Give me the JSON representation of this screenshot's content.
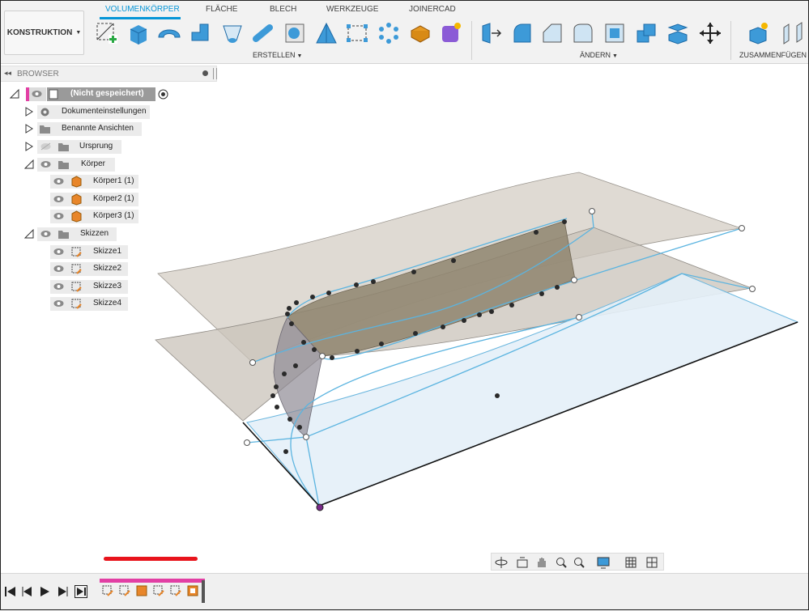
{
  "toolbar": {
    "workspace_label": "KONSTRUKTION",
    "tabs": [
      "VOLUMENKÖRPER",
      "FLÄCHE",
      "BLECH",
      "WERKZEUGE",
      "JOINERCAD"
    ],
    "active_tab": "VOLUMENKÖRPER",
    "groups": {
      "create": "ERSTELLEN",
      "modify": "ÄNDERN",
      "assemble": "ZUSAMMENFÜGEN"
    },
    "create_icons": [
      "sketch-icon",
      "extrude-icon",
      "revolve-icon",
      "sweep-icon",
      "loft-icon",
      "pipe-icon",
      "hole-icon",
      "thread-icon",
      "rib-icon",
      "web-icon",
      "pattern-icon",
      "emboss-icon",
      "form-icon"
    ],
    "modify_icons": [
      "press-pull-icon",
      "fillet-icon",
      "chamfer-icon",
      "shell-icon",
      "draft-icon",
      "combine-icon",
      "split-icon",
      "move-icon"
    ],
    "assemble_icons": [
      "new-component-icon",
      "joint-icon"
    ]
  },
  "browser": {
    "title": "BROWSER",
    "root": "(Nicht gespeichert)",
    "items": [
      {
        "label": "Dokumenteinstellungen"
      },
      {
        "label": "Benannte Ansichten"
      },
      {
        "label": "Ursprung"
      },
      {
        "label": "Körper"
      },
      {
        "label": "Körper1 (1)"
      },
      {
        "label": "Körper2 (1)"
      },
      {
        "label": "Körper3 (1)"
      },
      {
        "label": "Skizzen"
      },
      {
        "label": "Skizze1"
      },
      {
        "label": "Skizze2"
      },
      {
        "label": "Skizze3"
      },
      {
        "label": "Skizze4"
      }
    ]
  },
  "navbar": {
    "icons": [
      "orbit-icon",
      "look-at-icon",
      "pan-icon",
      "zoom-icon",
      "fit-icon",
      "display-settings-icon",
      "grid-icon",
      "viewports-icon"
    ]
  },
  "timeline": {
    "controls": [
      "first-icon",
      "previous-icon",
      "play-icon",
      "next-icon",
      "last-icon"
    ],
    "features": [
      "sketch",
      "sketch",
      "body",
      "sketch",
      "sketch",
      "body"
    ]
  },
  "colors": {
    "accent": "#0696d7",
    "timeline_track": "#e23fa4",
    "annotation": "#e8141c",
    "sketch_line": "#5bb4e0",
    "surface_fill": "#d8d3cc"
  }
}
